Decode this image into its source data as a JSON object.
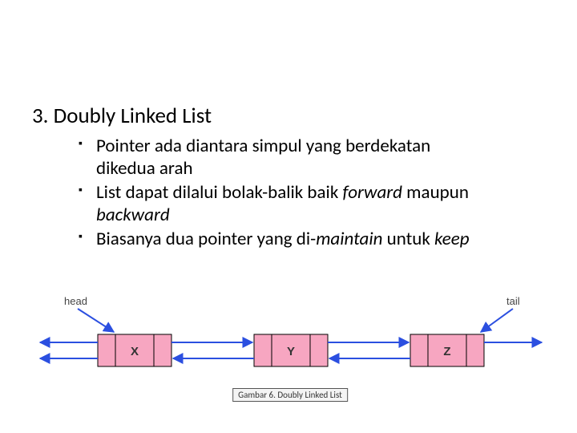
{
  "heading": "3. Doubly Linked List",
  "bullets": {
    "b1_a": "Pointer ada diantara simpul yang berdekatan",
    "b1_b": "dikedua arah",
    "b2_a": "List dapat dilalui bolak-balik baik ",
    "b2_fwd": "forward",
    "b2_mid": " maupun ",
    "b2_bwd": "backward",
    "b3_a": "Biasanya dua pointer yang di-",
    "b3_maintain": "maintain",
    "b3_b": " untuk ",
    "b3_keep": "keep"
  },
  "diagram": {
    "head_label": "head",
    "tail_label": "tail",
    "nodes": {
      "n1": "X",
      "n2": "Y",
      "n3": "Z"
    },
    "caption": "Gambar 6. Doubly Linked List"
  }
}
